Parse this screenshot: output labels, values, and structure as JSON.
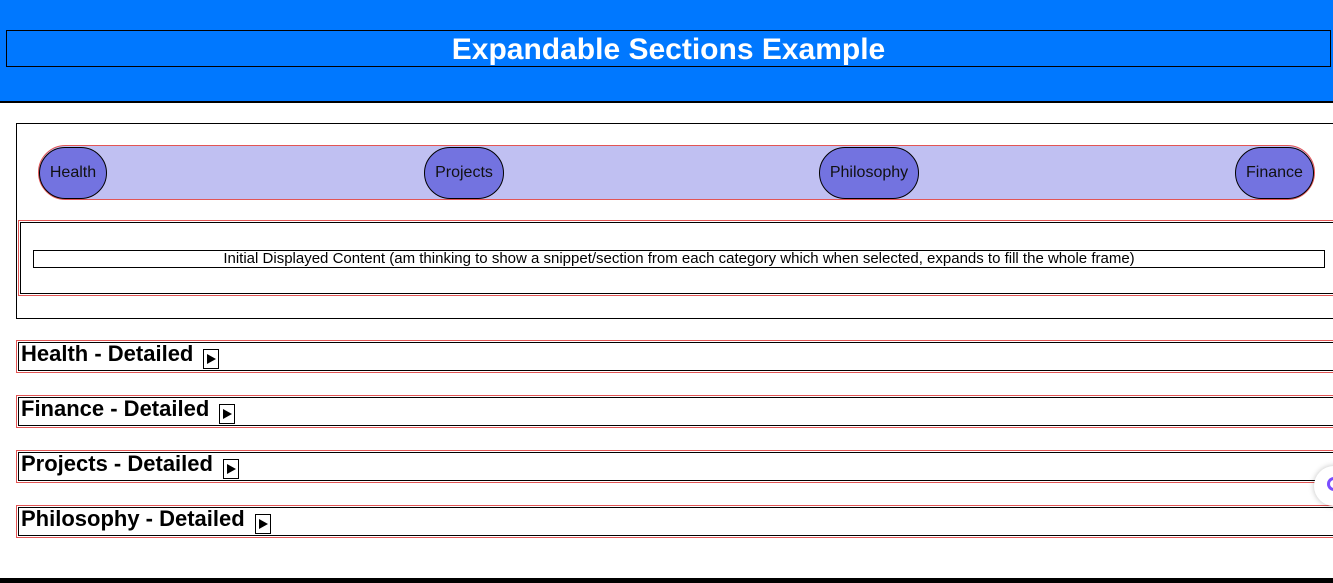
{
  "header": {
    "title": "Expandable Sections Example"
  },
  "nav": {
    "buttons": [
      "Health",
      "Projects",
      "Philosophy",
      "Finance"
    ]
  },
  "content": {
    "text": "Initial Displayed Content (am thinking to show a snippet/section from each category which when selected, expands to fill the whole frame)"
  },
  "sections": [
    {
      "title": "Health - Detailed"
    },
    {
      "title": "Finance - Detailed"
    },
    {
      "title": "Projects - Detailed"
    },
    {
      "title": "Philosophy - Detailed"
    }
  ],
  "icons": {
    "toggle": "play-triangle-icon",
    "widget": "assistant-icon"
  },
  "colors": {
    "header_bg": "#0078ff",
    "nav_bar_bg": "#c0c0f2",
    "nav_button_bg": "#7373e0",
    "outline_red": "#e25555"
  }
}
